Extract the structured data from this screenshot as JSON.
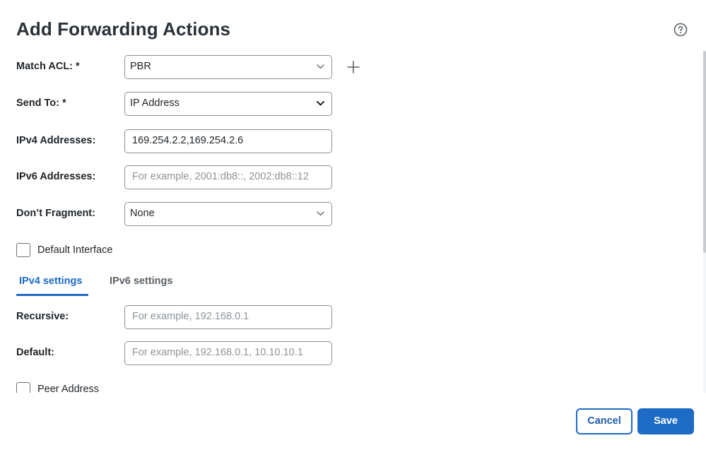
{
  "dialog": {
    "title": "Add Forwarding Actions"
  },
  "form": {
    "match_acl": {
      "label": "Match ACL: *",
      "value": "PBR"
    },
    "send_to": {
      "label": "Send To: *",
      "value": "IP Address"
    },
    "ipv4_addresses": {
      "label": "IPv4 Addresses:",
      "value": "169.254.2.2,169.254.2.6"
    },
    "ipv6_addresses": {
      "label": "IPv6 Addresses:",
      "placeholder": "For example, 2001:db8::, 2002:db8::12"
    },
    "dont_fragment": {
      "label": "Don’t Fragment:",
      "value": "None"
    },
    "default_interface": {
      "label": "Default Interface",
      "checked": false
    }
  },
  "tabs": [
    {
      "label": "IPv4 settings",
      "active": true
    },
    {
      "label": "IPv6 settings",
      "active": false
    }
  ],
  "ipv4_settings": {
    "recursive": {
      "label": "Recursive:",
      "placeholder": "For example, 192.168.0.1"
    },
    "default": {
      "label": "Default:",
      "placeholder": "For example, 192.168.0.1, 10.10.10.1"
    },
    "peer_address": {
      "label": "Peer Address",
      "checked": false
    }
  },
  "footer": {
    "cancel_label": "Cancel",
    "save_label": "Save"
  },
  "colors": {
    "accent": "#1d6bc5",
    "text": "#1f2429",
    "border": "#8a9097"
  }
}
